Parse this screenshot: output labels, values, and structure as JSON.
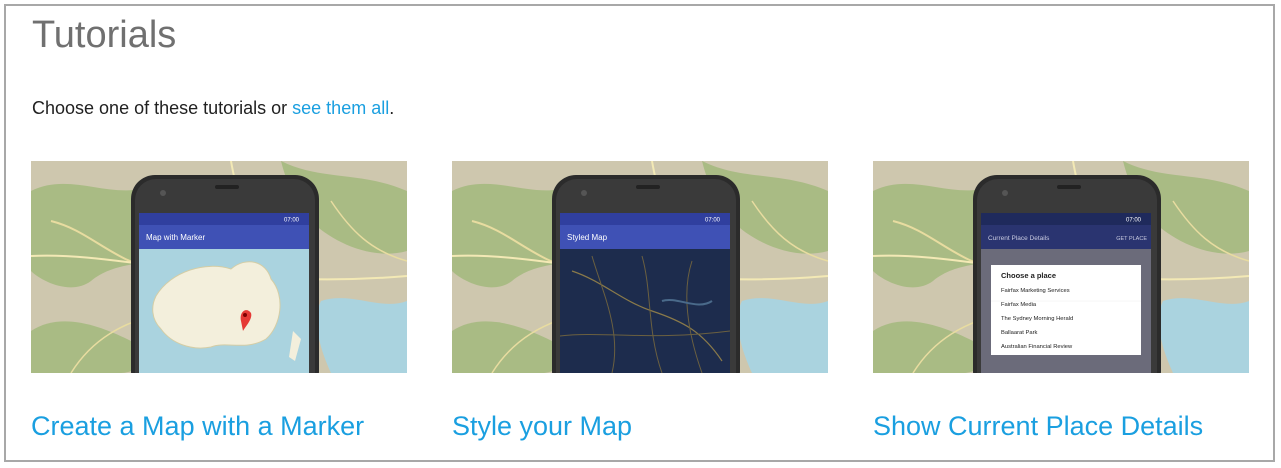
{
  "page": {
    "title": "Tutorials",
    "intro_text": "Choose one of these tutorials or ",
    "intro_link": "see them all",
    "intro_end": "."
  },
  "colors": {
    "link": "#1a9fe0",
    "app_bar": "#3f51b5",
    "status_bar": "#303f9f",
    "map_land": "#c9c0a4",
    "map_green": "#a9bb84",
    "map_water": "#aad3df",
    "phone_body": "#2b2b2b"
  },
  "status_time": "07:00",
  "cards": [
    {
      "title": "Create a Map with a Marker",
      "app_title": "Map with Marker",
      "thumbnail_icon": "map-marker-icon"
    },
    {
      "title": "Style your Map",
      "app_title": "Styled Map",
      "thumbnail_icon": "styled-map-icon"
    },
    {
      "title": "Show Current Place Details",
      "app_title": "Current Place Details",
      "app_action": "GET PLACE",
      "dialog_title": "Choose a place",
      "places": [
        "Fairfax Marketing Services",
        "Fairfax Media",
        "The Sydney Morning Herald",
        "Ballaarat Park",
        "Australian Financial Review"
      ]
    }
  ]
}
